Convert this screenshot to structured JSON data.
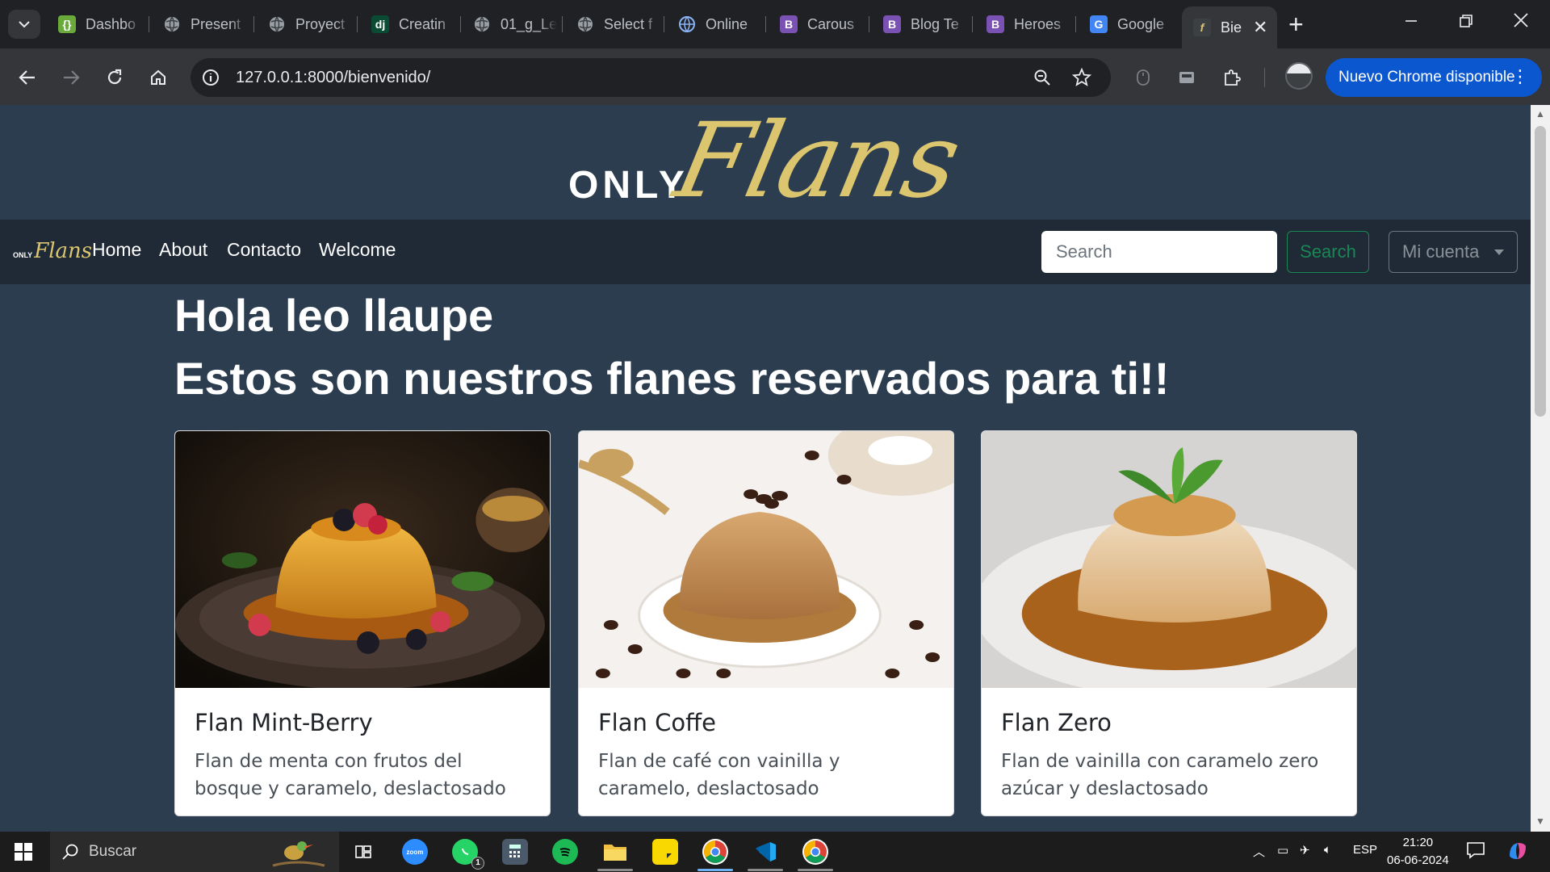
{
  "browser": {
    "tabs": [
      {
        "title": "Dashbo",
        "icon": "green-braces-icon",
        "color": "#6aaa3a"
      },
      {
        "title": "Present",
        "icon": "globe-icon",
        "color": "#5f6368"
      },
      {
        "title": "Proyect",
        "icon": "globe-icon",
        "color": "#5f6368"
      },
      {
        "title": "Creatin",
        "icon": "django-icon",
        "color": "#0c4b33"
      },
      {
        "title": "01_g_Le",
        "icon": "globe-icon",
        "color": "#5f6368"
      },
      {
        "title": "Select f",
        "icon": "globe-icon",
        "color": "#5f6368"
      },
      {
        "title": "Online",
        "icon": "web-icon",
        "color": "#4285f4"
      },
      {
        "title": "Carous",
        "icon": "bootstrap-icon",
        "color": "#7952b3"
      },
      {
        "title": "Blog Te",
        "icon": "bootstrap-icon",
        "color": "#7952b3"
      },
      {
        "title": "Heroes",
        "icon": "bootstrap-icon",
        "color": "#7952b3"
      },
      {
        "title": "Google",
        "icon": "google-translate-icon",
        "color": "#4285f4"
      }
    ],
    "active_tab": {
      "title": "Bie",
      "close": "✕"
    },
    "new_tab": "+",
    "url": "127.0.0.1:8000/bienvenido/",
    "update_button": "Nuevo Chrome disponible"
  },
  "site": {
    "logo_only": "ONLY",
    "logo_flans": "Flans",
    "mini_logo_only": "ONLY",
    "mini_logo_flans": "Flans",
    "accent": "#dcc56f",
    "nav": [
      "Home",
      "About",
      "Contacto",
      "Welcome"
    ],
    "search_placeholder": "Search",
    "search_button": "Search",
    "account_button": "Mi cuenta"
  },
  "main": {
    "greeting": "Hola leo llaupe",
    "subtitle": "Estos son nuestros flanes reservados para ti!!",
    "cards": [
      {
        "title": "Flan Mint-Berry",
        "text": "Flan de menta con frutos del bosque y caramelo, deslactosado"
      },
      {
        "title": "Flan Coffe",
        "text": "Flan de café con vainilla y caramelo, deslactosado"
      },
      {
        "title": "Flan Zero",
        "text": "Flan de vainilla con caramelo zero azúcar y deslactosado"
      }
    ]
  },
  "taskbar": {
    "search": "Buscar",
    "language": "ESP",
    "time": "21:20",
    "date": "06-06-2024",
    "whatsapp_badge": "1",
    "zoom_label": "zoom"
  }
}
